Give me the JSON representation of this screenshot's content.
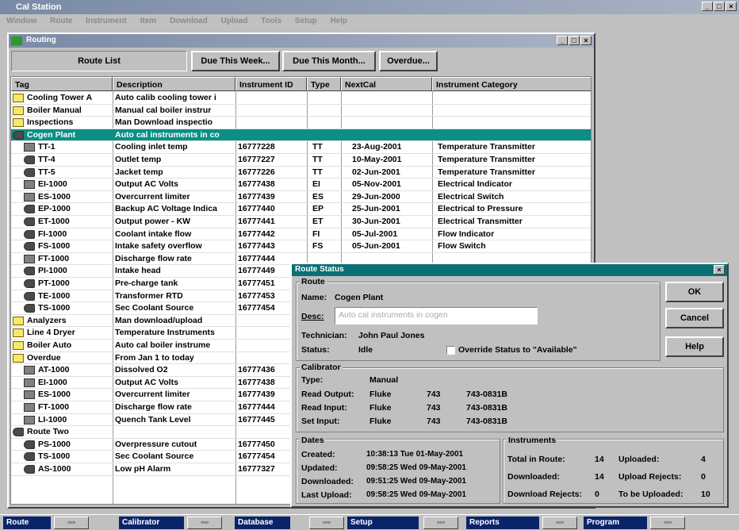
{
  "app": {
    "title": "Cal Station",
    "menu": [
      "Window",
      "Route",
      "Instrument",
      "Item",
      "Download",
      "Upload",
      "Tools",
      "Setup",
      "Help"
    ]
  },
  "routing": {
    "title": "Routing"
  },
  "toolbar": {
    "route_list": "Route List",
    "due_week": "Due This Week...",
    "due_month": "Due This Month...",
    "overdue": "Overdue..."
  },
  "columns": [
    "Tag",
    "Description",
    "Instrument ID",
    "Type",
    "NextCal",
    "Instrument Category"
  ],
  "rows": [
    {
      "icon": "folder",
      "indent": 0,
      "tag": "Cooling Tower A",
      "desc": "Auto calib cooling tower i",
      "id": "",
      "type": "",
      "next": "",
      "cat": ""
    },
    {
      "icon": "folder",
      "indent": 0,
      "tag": "Boiler Manual",
      "desc": "Manual cal boiler instrur",
      "id": "",
      "type": "",
      "next": "",
      "cat": ""
    },
    {
      "icon": "folder",
      "indent": 0,
      "tag": "Inspections",
      "desc": "Man Download inspectio",
      "id": "",
      "type": "",
      "next": "",
      "cat": ""
    },
    {
      "icon": "route",
      "indent": 0,
      "tag": "Cogen Plant",
      "desc": "Auto cal instruments in co",
      "id": "",
      "type": "",
      "next": "",
      "cat": "",
      "selected": true
    },
    {
      "icon": "instr",
      "indent": 1,
      "tag": "TT-1",
      "desc": "Cooling inlet temp",
      "id": "16777228",
      "type": "TT",
      "next": "23-Aug-2001",
      "cat": "Temperature Transmitter"
    },
    {
      "icon": "route",
      "indent": 1,
      "tag": "TT-4",
      "desc": "Outlet temp",
      "id": "16777227",
      "type": "TT",
      "next": "10-May-2001",
      "cat": "Temperature Transmitter"
    },
    {
      "icon": "route",
      "indent": 1,
      "tag": "TT-5",
      "desc": "Jacket temp",
      "id": "16777226",
      "type": "TT",
      "next": "02-Jun-2001",
      "cat": "Temperature Transmitter"
    },
    {
      "icon": "instr",
      "indent": 1,
      "tag": "EI-1000",
      "desc": "Output AC Volts",
      "id": "16777438",
      "type": "EI",
      "next": "05-Nov-2001",
      "cat": "Electrical Indicator"
    },
    {
      "icon": "instr",
      "indent": 1,
      "tag": "ES-1000",
      "desc": "Overcurrent limiter",
      "id": "16777439",
      "type": "ES",
      "next": "29-Jun-2000",
      "cat": "Electrical Switch"
    },
    {
      "icon": "route",
      "indent": 1,
      "tag": "EP-1000",
      "desc": "Backup AC Voltage Indica",
      "id": "16777440",
      "type": "EP",
      "next": "25-Jun-2001",
      "cat": "Electrical to Pressure"
    },
    {
      "icon": "route",
      "indent": 1,
      "tag": "ET-1000",
      "desc": "Output power - KW",
      "id": "16777441",
      "type": "ET",
      "next": "30-Jun-2001",
      "cat": "Electrical Transmitter"
    },
    {
      "icon": "route",
      "indent": 1,
      "tag": "FI-1000",
      "desc": "Coolant intake flow",
      "id": "16777442",
      "type": "FI",
      "next": "05-Jul-2001",
      "cat": "Flow Indicator"
    },
    {
      "icon": "route",
      "indent": 1,
      "tag": "FS-1000",
      "desc": "Intake safety overflow",
      "id": "16777443",
      "type": "FS",
      "next": "05-Jun-2001",
      "cat": "Flow Switch"
    },
    {
      "icon": "instr",
      "indent": 1,
      "tag": "FT-1000",
      "desc": "Discharge flow rate",
      "id": "16777444",
      "type": "",
      "next": "",
      "cat": ""
    },
    {
      "icon": "route",
      "indent": 1,
      "tag": "PI-1000",
      "desc": "Intake head",
      "id": "16777449",
      "type": "",
      "next": "",
      "cat": ""
    },
    {
      "icon": "route",
      "indent": 1,
      "tag": "PT-1000",
      "desc": "Pre-charge tank",
      "id": "16777451",
      "type": "",
      "next": "",
      "cat": ""
    },
    {
      "icon": "route",
      "indent": 1,
      "tag": "TE-1000",
      "desc": "Transformer RTD",
      "id": "16777453",
      "type": "",
      "next": "",
      "cat": ""
    },
    {
      "icon": "route",
      "indent": 1,
      "tag": "TS-1000",
      "desc": "Sec Coolant Source",
      "id": "16777454",
      "type": "",
      "next": "",
      "cat": ""
    },
    {
      "icon": "folder",
      "indent": 0,
      "tag": "Analyzers",
      "desc": "Man download/upload",
      "id": "",
      "type": "",
      "next": "",
      "cat": ""
    },
    {
      "icon": "folder",
      "indent": 0,
      "tag": "Line 4 Dryer",
      "desc": "Temperature Instruments",
      "id": "",
      "type": "",
      "next": "",
      "cat": ""
    },
    {
      "icon": "folder",
      "indent": 0,
      "tag": "Boiler Auto",
      "desc": "Auto cal boiler instrume",
      "id": "",
      "type": "",
      "next": "",
      "cat": ""
    },
    {
      "icon": "folder",
      "indent": 0,
      "tag": "Overdue",
      "desc": "From Jan 1 to today",
      "id": "",
      "type": "",
      "next": "",
      "cat": ""
    },
    {
      "icon": "instr",
      "indent": 1,
      "tag": "AT-1000",
      "desc": "Dissolved O2",
      "id": "16777436",
      "type": "",
      "next": "",
      "cat": ""
    },
    {
      "icon": "instr",
      "indent": 1,
      "tag": "EI-1000",
      "desc": "Output AC Volts",
      "id": "16777438",
      "type": "",
      "next": "",
      "cat": ""
    },
    {
      "icon": "instr",
      "indent": 1,
      "tag": "ES-1000",
      "desc": "Overcurrent limiter",
      "id": "16777439",
      "type": "",
      "next": "",
      "cat": ""
    },
    {
      "icon": "instr",
      "indent": 1,
      "tag": "FT-1000",
      "desc": "Discharge flow rate",
      "id": "16777444",
      "type": "",
      "next": "",
      "cat": ""
    },
    {
      "icon": "instr",
      "indent": 1,
      "tag": "LI-1000",
      "desc": "Quench Tank Level",
      "id": "16777445",
      "type": "",
      "next": "",
      "cat": ""
    },
    {
      "icon": "route",
      "indent": 0,
      "tag": "Route Two",
      "desc": "",
      "id": "",
      "type": "",
      "next": "",
      "cat": ""
    },
    {
      "icon": "route",
      "indent": 1,
      "tag": "PS-1000",
      "desc": "Overpressure cutout",
      "id": "16777450",
      "type": "",
      "next": "",
      "cat": ""
    },
    {
      "icon": "route",
      "indent": 1,
      "tag": "TS-1000",
      "desc": "Sec Coolant Source",
      "id": "16777454",
      "type": "",
      "next": "",
      "cat": ""
    },
    {
      "icon": "route",
      "indent": 1,
      "tag": "AS-1000",
      "desc": "Low pH Alarm",
      "id": "16777327",
      "type": "",
      "next": "",
      "cat": ""
    }
  ],
  "dialog": {
    "title": "Route Status",
    "ok": "OK",
    "cancel": "Cancel",
    "help": "Help",
    "route_group": "Route",
    "name_label": "Name:",
    "name_value": "Cogen Plant",
    "desc_label": "Desc:",
    "desc_value": "Auto cal instruments in cogen",
    "tech_label": "Technician:",
    "tech_value": "John Paul Jones",
    "status_label": "Status:",
    "status_value": "Idle",
    "override_label": "Override Status to \"Available\"",
    "calibrator_group": "Calibrator",
    "type_label": "Type:",
    "type_value": "Manual",
    "cal_rows": [
      {
        "label": "Read Output:",
        "make": "Fluke",
        "model": "743",
        "serial": "743-0831B"
      },
      {
        "label": "Read Input:",
        "make": "Fluke",
        "model": "743",
        "serial": "743-0831B"
      },
      {
        "label": "Set Input:",
        "make": "Fluke",
        "model": "743",
        "serial": "743-0831B"
      }
    ],
    "dates_group": "Dates",
    "dates": [
      {
        "label": "Created:",
        "value": "10:38:13 Tue 01-May-2001"
      },
      {
        "label": "Updated:",
        "value": "09:58:25 Wed 09-May-2001"
      },
      {
        "label": "Downloaded:",
        "value": "09:51:25 Wed 09-May-2001"
      },
      {
        "label": "Last Upload:",
        "value": "09:58:25 Wed 09-May-2001"
      }
    ],
    "instruments_group": "Instruments",
    "inst": {
      "total_label": "Total in Route:",
      "total": "14",
      "uploaded_label": "Uploaded:",
      "uploaded": "4",
      "downloaded_label": "Downloaded:",
      "downloaded": "14",
      "upload_rejects_label": "Upload Rejects:",
      "upload_rejects": "0",
      "download_rejects_label": "Download Rejects:",
      "download_rejects": "0",
      "to_upload_label": "To be Uploaded:",
      "to_upload": "10"
    }
  },
  "taskbar": {
    "items": [
      "Route",
      "Calibrator",
      "Database",
      "Setup",
      "Reports",
      "Program"
    ]
  }
}
